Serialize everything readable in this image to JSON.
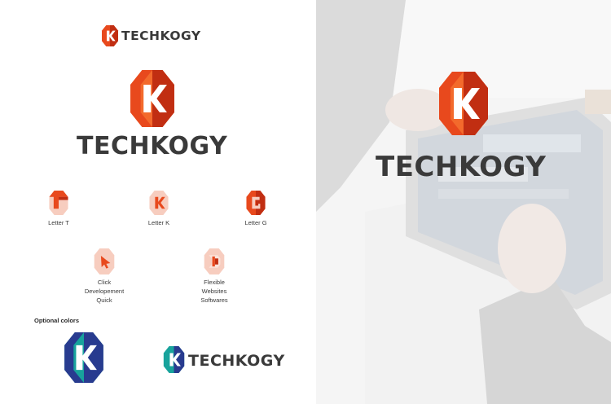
{
  "brand": {
    "name": "TECHKOGY",
    "colors": {
      "orange_main": "#e8491d",
      "orange_dark": "#c12e12",
      "orange_light": "#f36a2c",
      "peach": "#f7cdbf",
      "teal": "#18a39c",
      "blue": "#283b8f",
      "text": "#3a3a3a"
    }
  },
  "variants": [
    {
      "icon": "letter-t-logo-icon",
      "lines": [
        "Letter T"
      ]
    },
    {
      "icon": "letter-k-logo-icon",
      "lines": [
        "Letter K"
      ]
    },
    {
      "icon": "letter-g-logo-icon",
      "lines": [
        "Letter G"
      ]
    },
    {
      "icon": "click-logo-icon",
      "lines": [
        "Click",
        "Developement",
        "Quick"
      ]
    },
    {
      "icon": "flexible-logo-icon",
      "lines": [
        "Flexible",
        "Websites",
        "Softwares"
      ]
    }
  ],
  "optional_colors": {
    "title": "Optional colors"
  },
  "photo": {
    "description_icon": "tablet-photo-background"
  }
}
